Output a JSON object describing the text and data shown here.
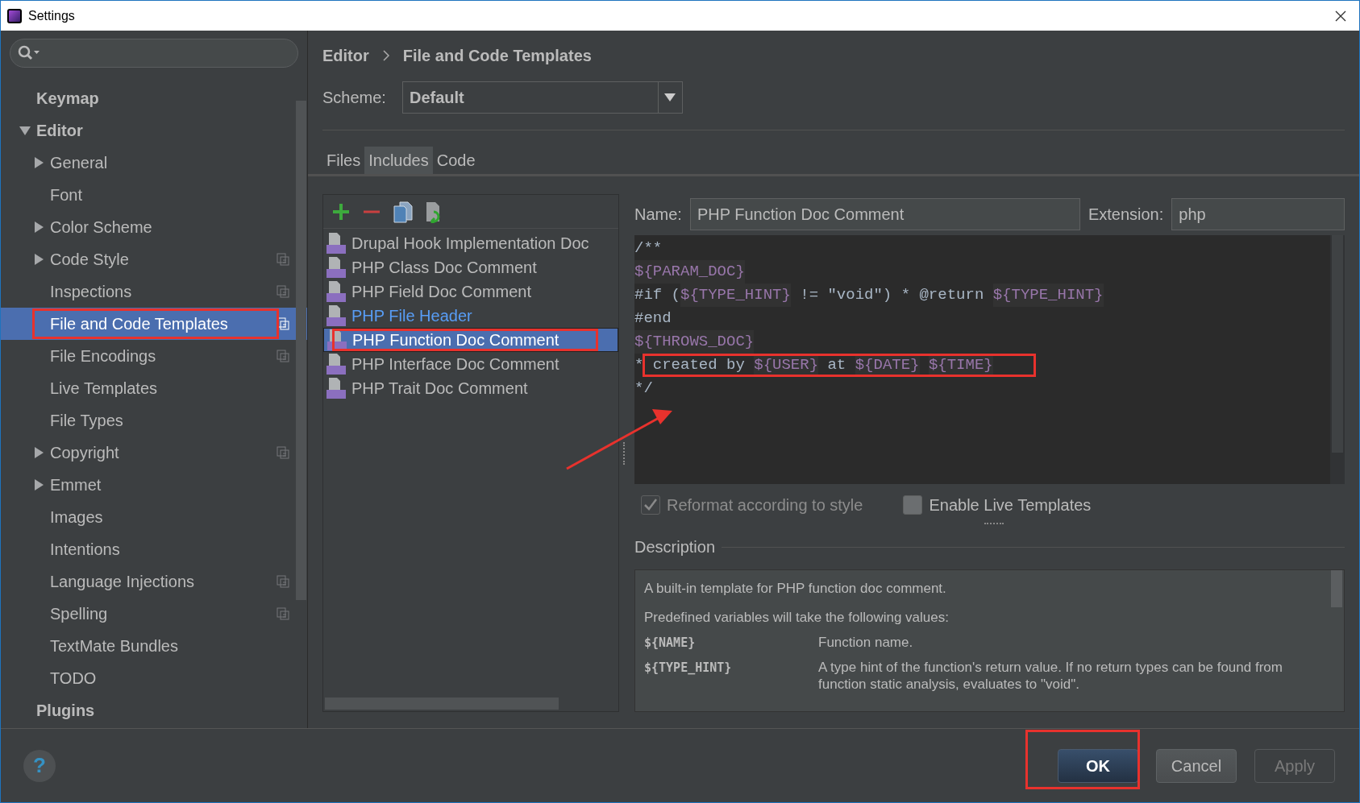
{
  "window": {
    "title": "Settings"
  },
  "sidebar": {
    "items": [
      {
        "label": "Keymap",
        "selected": false
      },
      {
        "label": "Editor",
        "expanded": true,
        "selected": false,
        "children": [
          {
            "label": "General",
            "expanded": false,
            "selected": false,
            "project_icon": false
          },
          {
            "label": "Font",
            "selected": false,
            "project_icon": false
          },
          {
            "label": "Color Scheme",
            "expanded": false,
            "selected": false,
            "project_icon": false
          },
          {
            "label": "Code Style",
            "expanded": false,
            "selected": false,
            "project_icon": true
          },
          {
            "label": "Inspections",
            "selected": false,
            "project_icon": true
          },
          {
            "label": "File and Code Templates",
            "selected": true,
            "project_icon": true,
            "annotated": true
          },
          {
            "label": "File Encodings",
            "selected": false,
            "project_icon": true
          },
          {
            "label": "Live Templates",
            "selected": false,
            "project_icon": false
          },
          {
            "label": "File Types",
            "selected": false,
            "project_icon": false
          },
          {
            "label": "Copyright",
            "expanded": false,
            "selected": false,
            "project_icon": true
          },
          {
            "label": "Emmet",
            "expanded": false,
            "selected": false,
            "project_icon": false
          },
          {
            "label": "Images",
            "selected": false,
            "project_icon": false
          },
          {
            "label": "Intentions",
            "selected": false,
            "project_icon": false
          },
          {
            "label": "Language Injections",
            "selected": false,
            "project_icon": true
          },
          {
            "label": "Spelling",
            "selected": false,
            "project_icon": true
          },
          {
            "label": "TextMate Bundles",
            "selected": false,
            "project_icon": false
          },
          {
            "label": "TODO",
            "selected": false,
            "project_icon": false
          }
        ]
      },
      {
        "label": "Plugins",
        "selected": false
      }
    ]
  },
  "breadcrumb": [
    "Editor",
    "File and Code Templates"
  ],
  "scheme": {
    "label": "Scheme:",
    "value": "Default"
  },
  "tabs": [
    {
      "label": "Files",
      "selected": false
    },
    {
      "label": "Includes",
      "selected": true
    },
    {
      "label": "Code",
      "selected": false
    }
  ],
  "templates": [
    {
      "label": "Drupal Hook Implementation Doc",
      "selected": false,
      "modified": false
    },
    {
      "label": "PHP Class Doc Comment",
      "selected": false,
      "modified": false
    },
    {
      "label": "PHP Field Doc Comment",
      "selected": false,
      "modified": false
    },
    {
      "label": "PHP File Header",
      "selected": false,
      "modified": true
    },
    {
      "label": "PHP Function Doc Comment",
      "selected": true,
      "modified": false,
      "annotated": true
    },
    {
      "label": "PHP Interface Doc Comment",
      "selected": false,
      "modified": false
    },
    {
      "label": "PHP Trait Doc Comment",
      "selected": false,
      "modified": false
    }
  ],
  "name_field": {
    "label": "Name:",
    "value": "PHP Function Doc Comment"
  },
  "extension_field": {
    "label": "Extension:",
    "value": "php"
  },
  "editor": {
    "annotation_arrow": true,
    "lines": [
      {
        "segments": [
          {
            "text": "/**",
            "kind": "plain"
          }
        ]
      },
      {
        "segments": [
          {
            "text": "${PARAM_DOC}",
            "kind": "variable"
          }
        ]
      },
      {
        "segments": [
          {
            "text": "#if (",
            "kind": "plain"
          },
          {
            "text": "${TYPE_HINT}",
            "kind": "variable"
          },
          {
            "text": " != \"void\") * @return ",
            "kind": "plain"
          },
          {
            "text": "${TYPE_HINT}",
            "kind": "variable"
          }
        ]
      },
      {
        "segments": [
          {
            "text": "#end",
            "kind": "plain"
          }
        ]
      },
      {
        "segments": [
          {
            "text": "${THROWS_DOC}",
            "kind": "variable"
          }
        ]
      },
      {
        "annotated": true,
        "segments": [
          {
            "text": "* created by ",
            "kind": "plain"
          },
          {
            "text": "${USER}",
            "kind": "variable"
          },
          {
            "text": " at ",
            "kind": "plain"
          },
          {
            "text": "${DATE}",
            "kind": "variable"
          },
          {
            "text": "${TIME}",
            "kind": "variable",
            "space_before": true
          }
        ]
      },
      {
        "segments": [
          {
            "text": "*/",
            "kind": "plain"
          }
        ]
      }
    ]
  },
  "options": [
    {
      "label": "Reformat according to style",
      "checked": true,
      "disabled": true
    },
    {
      "label": "Enable Live Templates",
      "checked": false,
      "disabled": false
    }
  ],
  "description": {
    "title": "Description",
    "paragraphs": [
      "A built-in template for PHP function doc comment.",
      "Predefined variables will take the following values:"
    ],
    "variables": [
      {
        "name": "${NAME}",
        "text": "Function name."
      },
      {
        "name": "${TYPE_HINT}",
        "text": "A type hint of the function's return value. If no return types can be found from function static analysis, evaluates to \"void\"."
      }
    ]
  },
  "help": "?",
  "buttons": [
    {
      "label": "OK",
      "primary": true,
      "disabled": false,
      "annotated": true
    },
    {
      "label": "Cancel",
      "primary": false,
      "disabled": false
    },
    {
      "label": "Apply",
      "primary": false,
      "disabled": true
    }
  ]
}
